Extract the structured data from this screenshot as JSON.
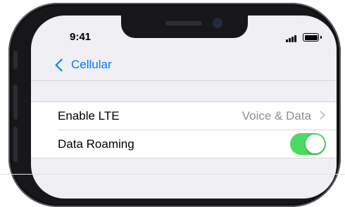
{
  "status_bar": {
    "time": "9:41",
    "signal_icon": "signal-icon",
    "battery_icon": "battery-icon"
  },
  "nav": {
    "back_label": "Cellular",
    "back_icon": "chevron-left-icon"
  },
  "settings": {
    "rows": [
      {
        "label": "Enable LTE",
        "value": "Voice & Data",
        "icon": "chevron-right-icon"
      },
      {
        "label": "Data Roaming",
        "toggle_on": true
      }
    ]
  },
  "colors": {
    "accent": "#007aff",
    "toggle_on": "#4cd964",
    "background": "#efeff4"
  }
}
